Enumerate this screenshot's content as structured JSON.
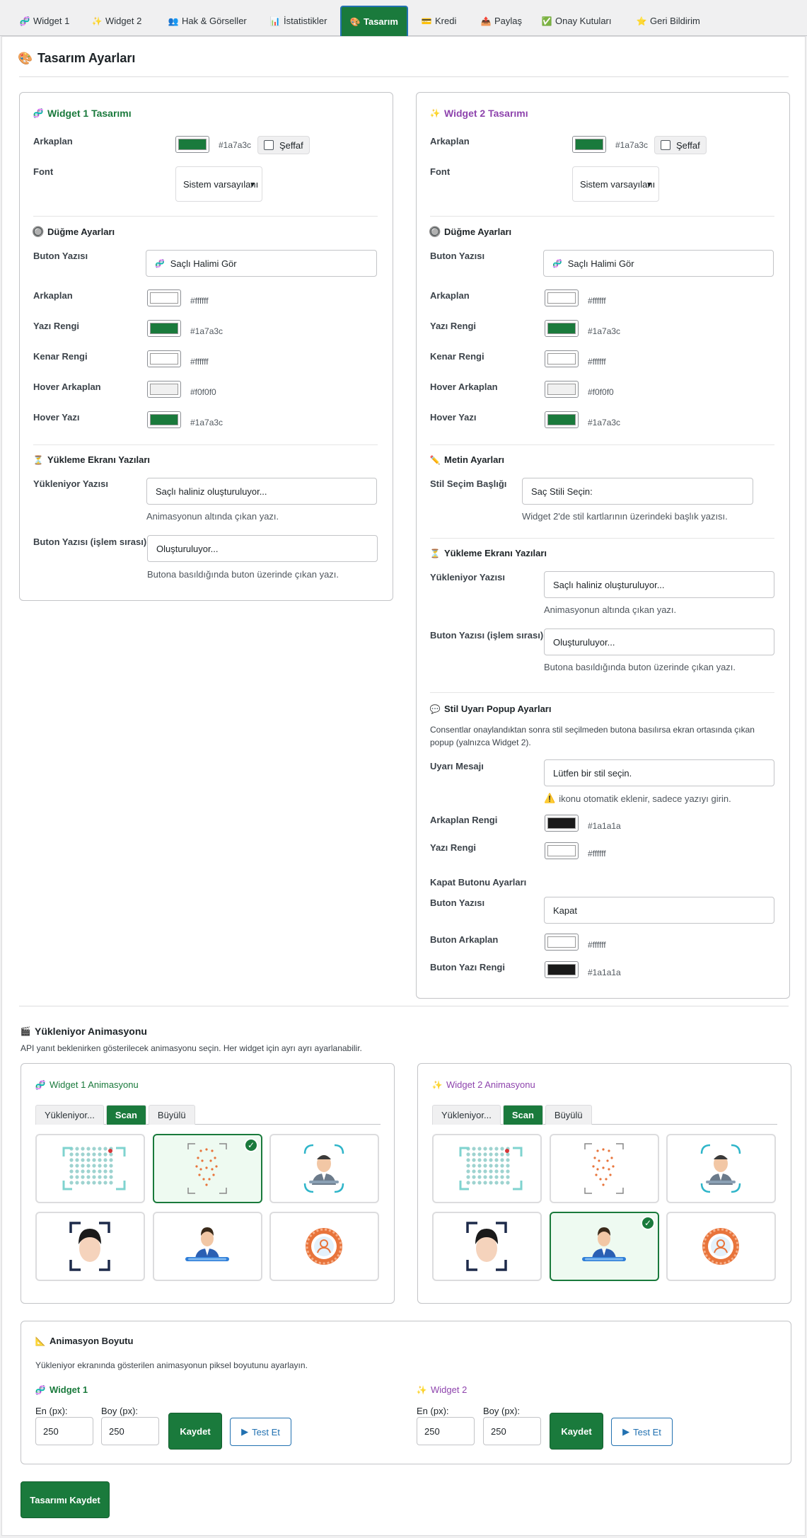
{
  "tabs": [
    {
      "label": "Widget 1",
      "icon": "dna-icon",
      "glyph": "🧬",
      "active": false
    },
    {
      "label": "Widget 2",
      "icon": "sparkles-icon",
      "glyph": "✨",
      "active": false
    },
    {
      "label": "Hak & Görseller",
      "icon": "people-icon",
      "glyph": "👥",
      "active": false
    },
    {
      "label": "İstatistikler",
      "icon": "chart-icon",
      "glyph": "📊",
      "active": false
    },
    {
      "label": "Tasarım",
      "icon": "palette-icon",
      "glyph": "🎨",
      "active": true
    },
    {
      "label": "Kredi",
      "icon": "credit-card-icon",
      "glyph": "💳",
      "active": false
    },
    {
      "label": "Paylaş",
      "icon": "share-icon",
      "glyph": "📤",
      "active": false
    },
    {
      "label": "Onay Kutuları",
      "icon": "check-icon",
      "glyph": "✅",
      "active": false
    },
    {
      "label": "Geri Bildirim",
      "icon": "star-icon",
      "glyph": "⭐",
      "active": false
    }
  ],
  "page_title": "Tasarım Ayarları",
  "colors": {
    "accent": "#1a7a3c",
    "purple": "#8e44ad",
    "blue": "#2271b1"
  },
  "w1": {
    "title": "Widget 1 Tasarımı",
    "bg_label": "Arkaplan",
    "bg_hex": "#1a7a3c",
    "transparent_label": "Şeffaf",
    "font_label": "Font",
    "font_value": "Sistem varsayılanı",
    "btn_section": "Düğme Ayarları",
    "btn_text_label": "Buton Yazısı",
    "btn_text_value": "Saçlı Halimi Gör",
    "bg2_label": "Arkaplan",
    "bg2_hex": "#ffffff",
    "text_color_label": "Yazı Rengi",
    "text_color_hex": "#1a7a3c",
    "border_label": "Kenar Rengi",
    "border_hex": "#ffffff",
    "hover_bg_label": "Hover Arkaplan",
    "hover_bg_hex": "#f0f0f0",
    "hover_text_label": "Hover Yazı",
    "hover_text_hex": "#1a7a3c",
    "loading_section": "Yükleme Ekranı Yazıları",
    "loading_label": "Yükleniyor Yazısı",
    "loading_value": "Saçlı haliniz oluşturuluyor...",
    "loading_help": "Animasyonun altında çıkan yazı.",
    "process_label": "Buton Yazısı (işlem sırası)",
    "process_value": "Oluşturuluyor...",
    "process_help": "Butona basıldığında buton üzerinde çıkan yazı."
  },
  "w2": {
    "title": "Widget 2 Tasarımı",
    "bg_label": "Arkaplan",
    "bg_hex": "#1a7a3c",
    "transparent_label": "Şeffaf",
    "font_label": "Font",
    "font_value": "Sistem varsayılanı",
    "btn_section": "Düğme Ayarları",
    "btn_text_label": "Buton Yazısı",
    "btn_text_value": "Saçlı Halimi Gör",
    "bg2_label": "Arkaplan",
    "bg2_hex": "#ffffff",
    "text_color_label": "Yazı Rengi",
    "text_color_hex": "#1a7a3c",
    "border_label": "Kenar Rengi",
    "border_hex": "#ffffff",
    "hover_bg_label": "Hover Arkaplan",
    "hover_bg_hex": "#f0f0f0",
    "hover_text_label": "Hover Yazı",
    "hover_text_hex": "#1a7a3c",
    "text_section": "Metin Ayarları",
    "style_title_label": "Stil Seçim Başlığı",
    "style_title_value": "Saç Stili Seçin:",
    "style_title_help": "Widget 2'de stil kartlarının üzerindeki başlık yazısı.",
    "loading_section": "Yükleme Ekranı Yazıları",
    "loading_label": "Yükleniyor Yazısı",
    "loading_value": "Saçlı haliniz oluşturuluyor...",
    "loading_help": "Animasyonun altında çıkan yazı.",
    "process_label": "Buton Yazısı (işlem sırası)",
    "process_value": "Oluşturuluyor...",
    "process_help": "Butona basıldığında buton üzerinde çıkan yazı.",
    "popup_section": "Stil Uyarı Popup Ayarları",
    "popup_desc_1": "Consentlar onaylandıktan sonra stil seçilmeden butona basılırsa ekran ortasında çıkan",
    "popup_desc_2": "popup (yalnızca Widget 2).",
    "warn_label": "Uyarı Mesajı",
    "warn_value": "Lütfen bir stil seçin.",
    "warn_help": "ikonu otomatik eklenir, sadece yazıyı girin.",
    "popup_bg_label": "Arkaplan Rengi",
    "popup_bg_hex": "#1a1a1a",
    "popup_text_label": "Yazı Rengi",
    "popup_text_hex": "#ffffff",
    "close_section": "Kapat Butonu Ayarları",
    "close_text_label": "Buton Yazısı",
    "close_text_value": "Kapat",
    "close_bg_label": "Buton Arkaplan",
    "close_bg_hex": "#ffffff",
    "close_fg_label": "Buton Yazı Rengi",
    "close_fg_hex": "#1a1a1a"
  },
  "anim": {
    "title": "Yükleniyor Animasyonu",
    "desc": "API yanıt beklenirken gösterilecek animasyonu seçin. Her widget için ayrı ayrı ayarlanabilir.",
    "w1_title": "Widget 1 Animasyonu",
    "w2_title": "Widget 2 Animasyonu",
    "tabs": [
      "Yükleniyor...",
      "Scan",
      "Büyülü"
    ],
    "active_tab": "Scan"
  },
  "size": {
    "title": "Animasyon Boyutu",
    "desc": "Yükleniyor ekranında gösterilen animasyonun piksel boyutunu ayarlayın.",
    "w1_label": "Widget 1",
    "w2_label": "Widget 2",
    "width_label": "En (px):",
    "height_label": "Boy (px):",
    "w1_width": "250",
    "w1_height": "250",
    "w2_width": "250",
    "w2_height": "250",
    "save_label": "Kaydet",
    "test_label": "Test Et"
  },
  "save_design_label": "Tasarımı Kaydet"
}
